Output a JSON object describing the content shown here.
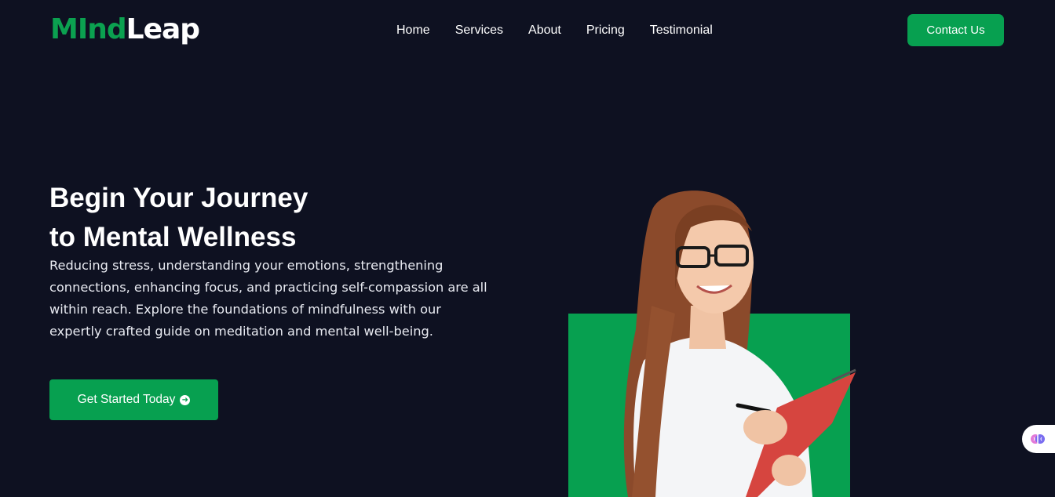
{
  "brand": {
    "part1": "MInd",
    "part2": "Leap"
  },
  "nav": {
    "items": [
      {
        "label": "Home"
      },
      {
        "label": "Services"
      },
      {
        "label": "About"
      },
      {
        "label": "Pricing"
      },
      {
        "label": "Testimonial"
      }
    ],
    "contact_label": "Contact Us"
  },
  "hero": {
    "title_line1": "Begin Your Journey",
    "title_line2": "to Mental Wellness",
    "description": "Reducing stress, understanding your emotions, strengthening connections, enhancing focus, and practicing self-compassion are all within reach. Explore the foundations of mindfulness with our expertly crafted guide on meditation and mental well-being.",
    "cta_label": "Get Started Today",
    "cta_icon": "arrow-circle-right-icon"
  },
  "colors": {
    "background": "#0e1121",
    "accent": "#07a050",
    "text": "#ffffff"
  },
  "widget": {
    "icon": "brain-icon"
  }
}
